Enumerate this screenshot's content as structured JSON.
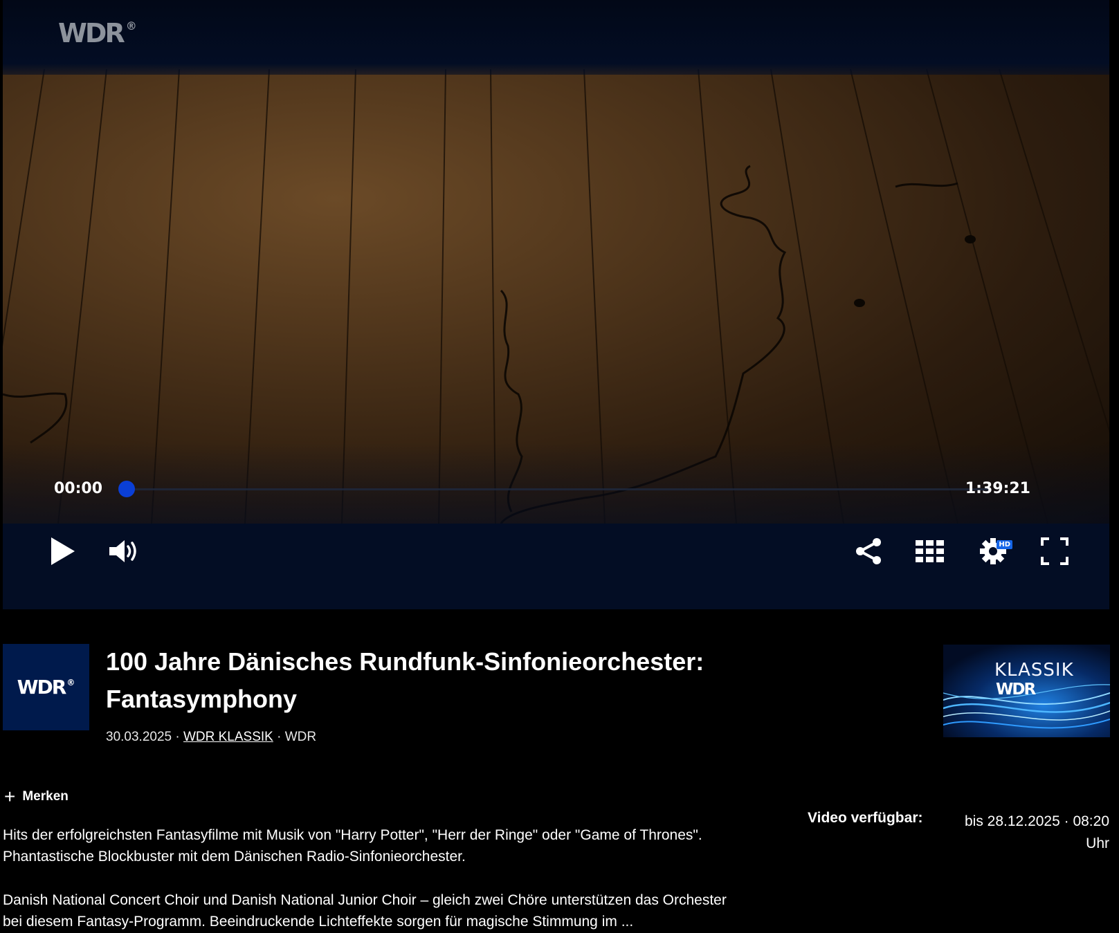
{
  "player": {
    "watermark": "WDR",
    "current_time": "00:00",
    "total_time": "1:39:21",
    "progress": 0,
    "hd_badge": "HD",
    "controls": [
      "play-icon",
      "volume-icon",
      "share-icon",
      "grid-icon",
      "settings-icon",
      "fullscreen-icon"
    ],
    "accent_color": "#0a3fd6"
  },
  "sender_logo": {
    "text": "WDR"
  },
  "program": {
    "title": "100 Jahre Dänisches Rundfunk-Sinfonieorchester: Fantasymphony",
    "date": "30.03.2025",
    "sep1": " · ",
    "channel_link": "WDR KLASSIK",
    "sep2": " · ",
    "broadcaster": "WDR"
  },
  "channel_thumb": {
    "line1": "KLASSIK",
    "line2": "WDR"
  },
  "actions": {
    "merken_label": "Merken"
  },
  "availability": {
    "label": "Video verfügbar:",
    "value": "bis 28.12.2025 · 08:20 Uhr"
  },
  "description": {
    "paragraph1": "Hits der erfolgreichsten Fantasyfilme mit Musik von \"Harry Potter\", \"Herr der Ringe\" oder \"Game of Thrones\". Phantastische Blockbuster mit dem Dänischen Radio-Sinfonieorchester.",
    "paragraph2": "Danish National Concert Choir und Danish National Junior Choir – gleich zwei Chöre unterstützen das Orchester bei diesem Fantasy-Programm. Beeindruckende Lichteffekte sorgen für magische Stimmung im ..."
  }
}
